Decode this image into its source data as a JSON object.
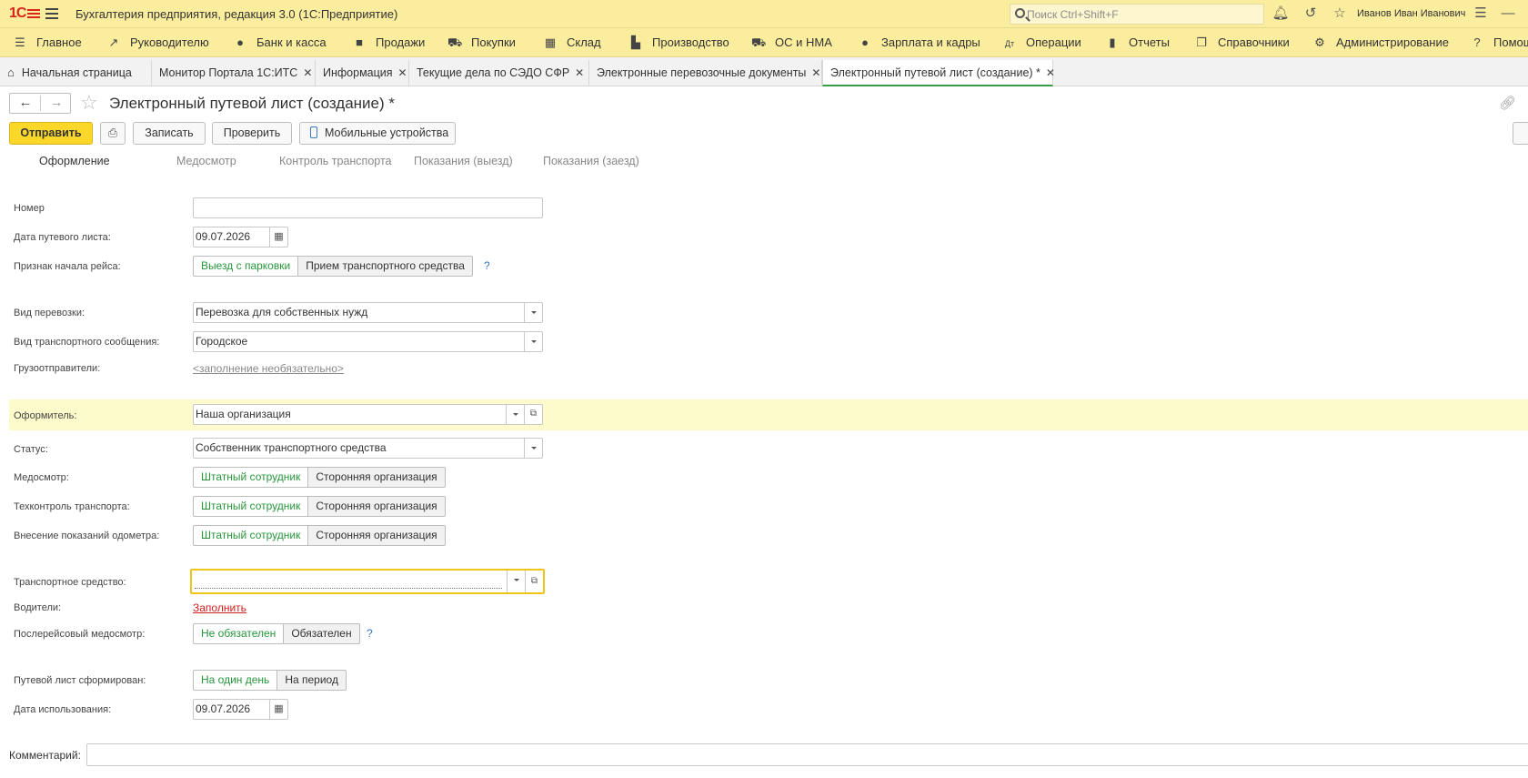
{
  "titlebar": {
    "logo": "1С",
    "app_title": "Бухгалтерия предприятия, редакция 3.0  (1С:Предприятие)",
    "search_placeholder": "Поиск Ctrl+Shift+F",
    "user": "Иванов Иван Иванович",
    "icons": [
      "bell-icon",
      "history-icon",
      "star-icon",
      "settings-icon"
    ]
  },
  "menu": {
    "items": [
      {
        "label": "Главное",
        "icon": "hamburger-icon"
      },
      {
        "label": "Руководителю",
        "icon": "trend-icon"
      },
      {
        "label": "Банк и касса",
        "icon": "coin-icon"
      },
      {
        "label": "Продажи",
        "icon": "bag-icon"
      },
      {
        "label": "Покупки",
        "icon": "cart-icon"
      },
      {
        "label": "Склад",
        "icon": "grid-icon"
      },
      {
        "label": "Производство",
        "icon": "factory-icon"
      },
      {
        "label": "ОС и НМА",
        "icon": "truck-icon"
      },
      {
        "label": "Зарплата и кадры",
        "icon": "person-icon"
      },
      {
        "label": "Операции",
        "icon": "dt-kt-icon"
      },
      {
        "label": "Отчеты",
        "icon": "chart-icon"
      },
      {
        "label": "Справочники",
        "icon": "book-icon"
      },
      {
        "label": "Администрирование",
        "icon": "gear-icon"
      },
      {
        "label": "Помощь",
        "icon": "question-icon"
      }
    ]
  },
  "tabs": [
    {
      "label": "Начальная страница"
    },
    {
      "label": "Монитор Портала 1С:ИТС"
    },
    {
      "label": "Информация"
    },
    {
      "label": "Текущие дела по СЭДО СФР"
    },
    {
      "label": "Электронные перевозочные документы"
    },
    {
      "label": "Электронный путевой лист (создание) *"
    }
  ],
  "document": {
    "title": "Электронный путевой лист (создание) *"
  },
  "toolbar": {
    "send": "Отправить",
    "save": "Записать",
    "check": "Проверить",
    "mobile": "Мобильные устройства"
  },
  "subtabs": [
    "Оформление",
    "Медосмотр",
    "Контроль транспорта",
    "Показания (выезд)",
    "Показания (заезд)"
  ],
  "form": {
    "number": {
      "label": "Номер",
      "value": ""
    },
    "date": {
      "label": "Дата путевого листа:",
      "value": "09.07.2026"
    },
    "trip_start": {
      "label": "Признак начала рейса:",
      "options": [
        "Выезд с парковки",
        "Прием транспортного средства"
      ]
    },
    "transport_kind": {
      "label": "Вид перевозки:",
      "value": "Перевозка для собственных нужд"
    },
    "transport_message": {
      "label": "Вид транспортного сообщения:",
      "value": "Городское"
    },
    "shippers": {
      "label": "Грузоотправители:",
      "value": "<заполнение необязательно>"
    },
    "issuer": {
      "label": "Оформитель:",
      "value": "Наша организация"
    },
    "status": {
      "label": "Статус:",
      "value": "Собственник транспортного средства"
    },
    "medical": {
      "label": "Медосмотр:",
      "options": [
        "Штатный сотрудник",
        "Сторонняя организация"
      ]
    },
    "tech_control": {
      "label": "Техконтроль транспорта:",
      "options": [
        "Штатный сотрудник",
        "Сторонняя организация"
      ]
    },
    "odometer": {
      "label": "Внесение показаний одометра:",
      "options": [
        "Штатный сотрудник",
        "Сторонняя организация"
      ]
    },
    "vehicle": {
      "label": "Транспортное средство:",
      "value": ""
    },
    "drivers": {
      "label": "Водители:",
      "value": "Заполнить"
    },
    "post_trip": {
      "label": "Послерейсовый медосмотр:",
      "options": [
        "Не обязателен",
        "Обязателен"
      ]
    },
    "formed": {
      "label": "Путевой лист сформирован:",
      "options": [
        "На один день",
        "На период"
      ]
    },
    "use_date": {
      "label": "Дата использования:",
      "value": "09.07.2026"
    },
    "comment": {
      "label": "Комментарий:",
      "value": ""
    }
  },
  "help_mark": "?"
}
